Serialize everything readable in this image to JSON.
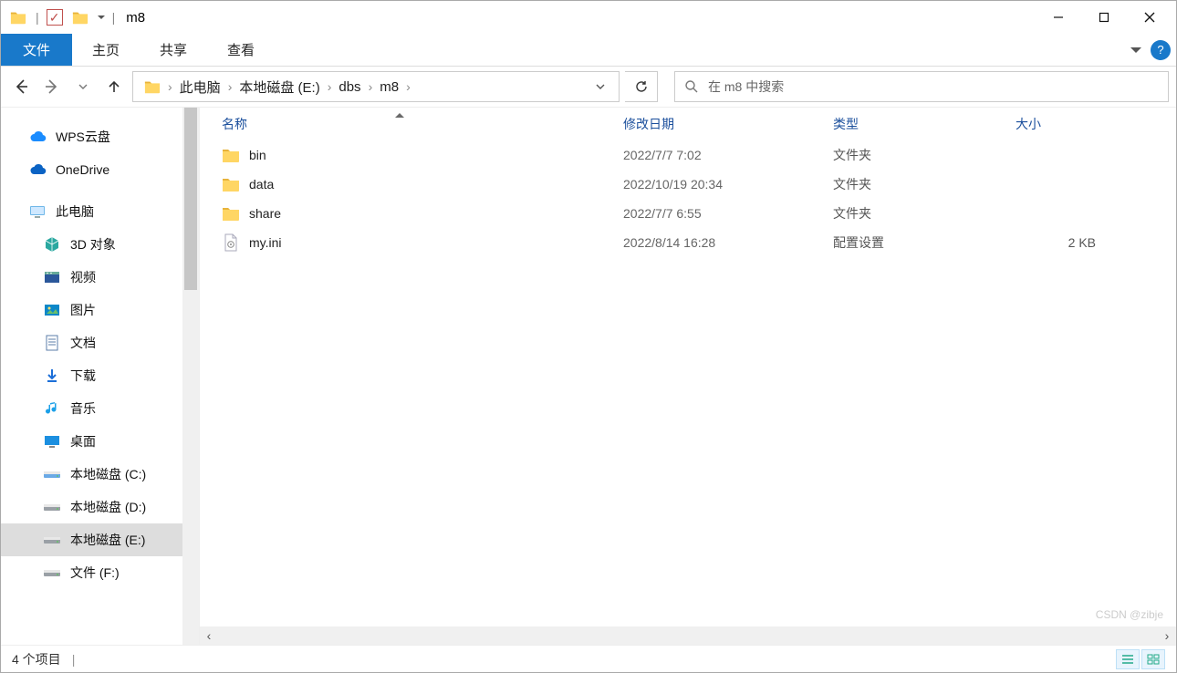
{
  "window": {
    "title": "m8"
  },
  "ribbon": {
    "file": "文件",
    "tabs": [
      "主页",
      "共享",
      "查看"
    ]
  },
  "nav": {
    "crumbs": [
      "此电脑",
      "本地磁盘 (E:)",
      "dbs",
      "m8"
    ],
    "search_placeholder": "在 m8 中搜索"
  },
  "sidebar": {
    "items": [
      {
        "label": "WPS云盘",
        "icon": "cloud",
        "color": "#1a8cff",
        "indent": false
      },
      {
        "label": "OneDrive",
        "icon": "cloud",
        "color": "#0b63c4",
        "indent": false
      },
      {
        "label": "此电脑",
        "icon": "pc",
        "color": "#6fb7e8",
        "indent": false
      },
      {
        "label": "3D 对象",
        "icon": "cube",
        "color": "#2aa8a0",
        "indent": true
      },
      {
        "label": "视频",
        "icon": "video",
        "color": "#2b579a",
        "indent": true
      },
      {
        "label": "图片",
        "icon": "image",
        "color": "#0c87c8",
        "indent": true
      },
      {
        "label": "文档",
        "icon": "doc",
        "color": "#5b7ea8",
        "indent": true
      },
      {
        "label": "下载",
        "icon": "download",
        "color": "#1c6fd8",
        "indent": true
      },
      {
        "label": "音乐",
        "icon": "music",
        "color": "#1ca0e8",
        "indent": true
      },
      {
        "label": "桌面",
        "icon": "desktop",
        "color": "#1c8fe0",
        "indent": true
      },
      {
        "label": "本地磁盘 (C:)",
        "icon": "drive",
        "color": "#6aa9e6",
        "indent": true
      },
      {
        "label": "本地磁盘 (D:)",
        "icon": "drive",
        "color": "#9aa0a6",
        "indent": true
      },
      {
        "label": "本地磁盘 (E:)",
        "icon": "drive",
        "color": "#9aa0a6",
        "indent": true,
        "selected": true
      },
      {
        "label": "文件 (F:)",
        "icon": "drive",
        "color": "#9aa0a6",
        "indent": true
      }
    ]
  },
  "columns": {
    "name": "名称",
    "date": "修改日期",
    "type": "类型",
    "size": "大小"
  },
  "files": [
    {
      "name": "bin",
      "date": "2022/7/7 7:02",
      "type": "文件夹",
      "size": "",
      "icon": "folder"
    },
    {
      "name": "data",
      "date": "2022/10/19 20:34",
      "type": "文件夹",
      "size": "",
      "icon": "folder"
    },
    {
      "name": "share",
      "date": "2022/7/7 6:55",
      "type": "文件夹",
      "size": "",
      "icon": "folder"
    },
    {
      "name": "my.ini",
      "date": "2022/8/14 16:28",
      "type": "配置设置",
      "size": "2 KB",
      "icon": "ini"
    }
  ],
  "status": {
    "text": "4 个项目"
  },
  "watermark": "CSDN @zibje"
}
